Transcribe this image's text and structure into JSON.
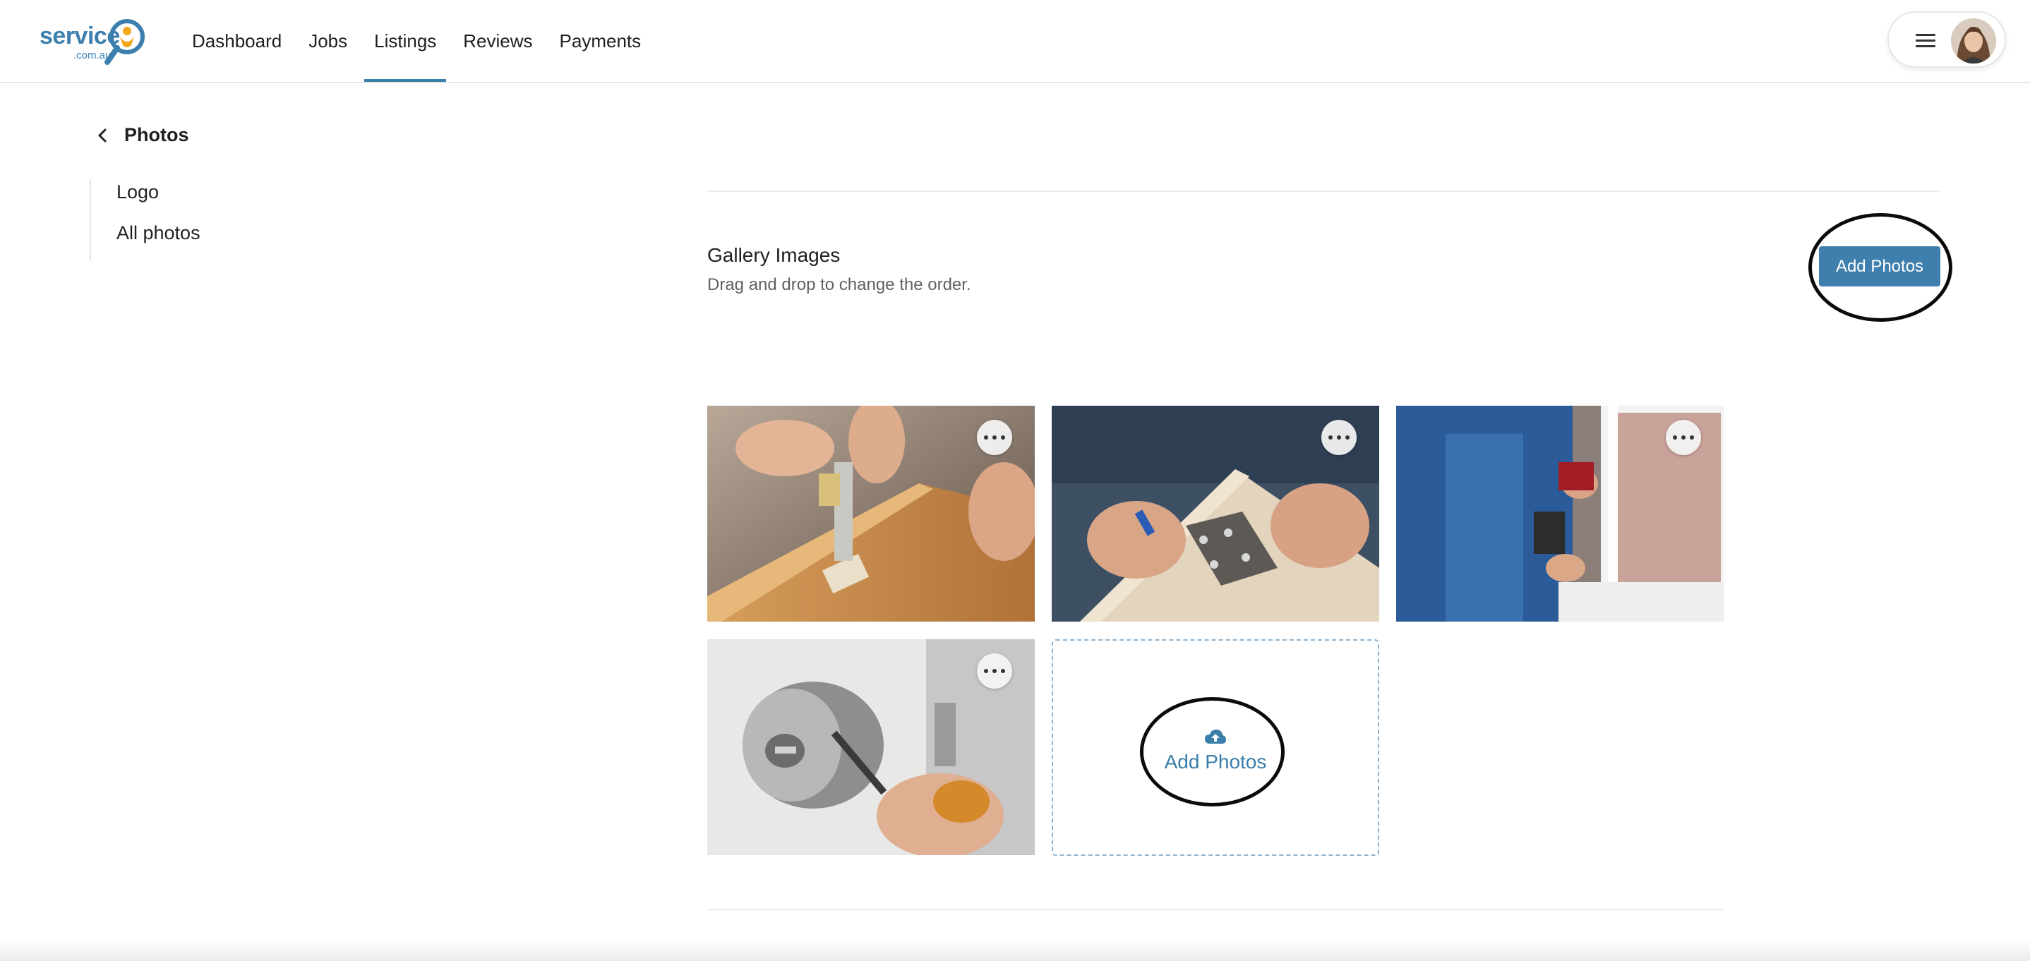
{
  "brand": {
    "logo_word": "service",
    "logo_sub": ".com.au"
  },
  "nav": {
    "items": [
      {
        "label": "Dashboard",
        "active": false
      },
      {
        "label": "Jobs",
        "active": false
      },
      {
        "label": "Listings",
        "active": true
      },
      {
        "label": "Reviews",
        "active": false
      },
      {
        "label": "Payments",
        "active": false
      }
    ]
  },
  "sidebar": {
    "back_label": "Photos",
    "items": [
      {
        "label": "Logo"
      },
      {
        "label": "All photos"
      }
    ]
  },
  "gallery": {
    "title": "Gallery Images",
    "subtitle": "Drag and drop to change the order.",
    "add_button_label": "Add Photos",
    "add_tile_label": "Add Photos",
    "photos": [
      {
        "subject": "door-latch-installation"
      },
      {
        "subject": "door-hinge"
      },
      {
        "subject": "drilling-window-frame"
      },
      {
        "subject": "door-knob-repair"
      }
    ]
  },
  "colors": {
    "accent": "#3f7fad",
    "nav_active_underline": "#3a7ea9",
    "annotation_ring": "#0b0b0b"
  },
  "icons": {
    "menu": "hamburger-icon",
    "back": "chevron-left-icon",
    "photo_options": "more-horizontal-icon",
    "upload": "cloud-upload-icon"
  }
}
